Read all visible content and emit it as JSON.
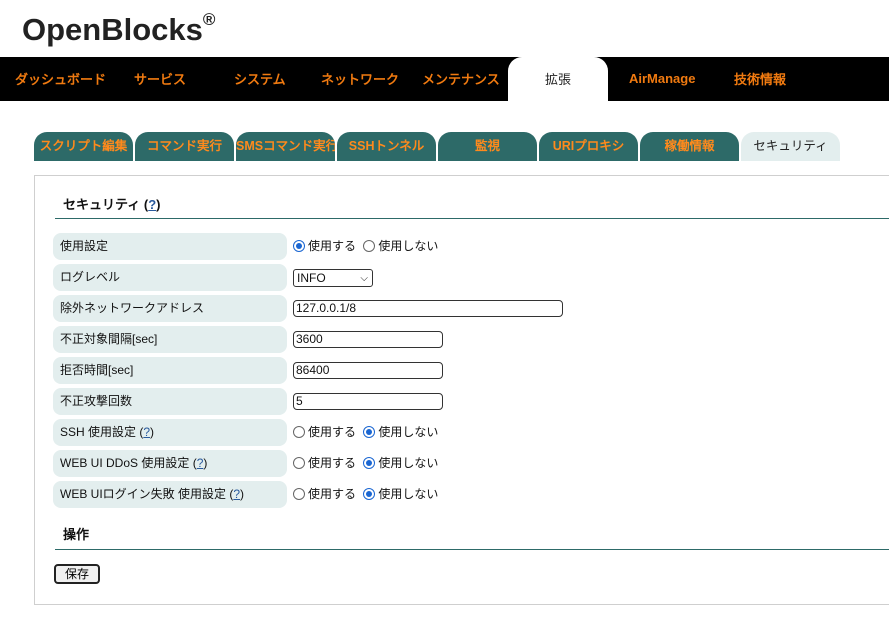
{
  "brand": {
    "name": "OpenBlocks",
    "mark": "®"
  },
  "topnav": {
    "items": [
      {
        "label": "ダッシュボード"
      },
      {
        "label": "サービス"
      },
      {
        "label": "システム"
      },
      {
        "label": "ネットワーク"
      },
      {
        "label": "メンテナンス"
      },
      {
        "label": "拡張",
        "active": true
      },
      {
        "label": "AirManage"
      },
      {
        "label": "技術情報"
      }
    ]
  },
  "subtabs": {
    "items": [
      {
        "label": "スクリプト編集"
      },
      {
        "label": "コマンド実行"
      },
      {
        "label": "SMSコマンド実行"
      },
      {
        "label": "SSHトンネル"
      },
      {
        "label": "監視"
      },
      {
        "label": "URIプロキシ"
      },
      {
        "label": "稼働情報"
      },
      {
        "label": "セキュリティ",
        "active": true
      }
    ]
  },
  "security": {
    "title": "セキュリティ",
    "help_open": "(",
    "help_mark": "?",
    "help_close": ")",
    "rows": {
      "usage": {
        "label": "使用設定",
        "opt_on": "使用する",
        "opt_off": "使用しない",
        "selected": "on"
      },
      "loglevel": {
        "label": "ログレベル",
        "value": "INFO"
      },
      "exclude": {
        "label": "除外ネットワークアドレス",
        "value": "127.0.0.1/8"
      },
      "interval": {
        "label": "不正対象間隔[sec]",
        "value": "3600"
      },
      "deny": {
        "label": "拒否時間[sec]",
        "value": "86400"
      },
      "attempts": {
        "label": "不正攻撃回数",
        "value": "5"
      },
      "ssh": {
        "label": "SSH 使用設定 ",
        "opt_on": "使用する",
        "opt_off": "使用しない",
        "selected": "off"
      },
      "ddos": {
        "label": "WEB UI DDoS 使用設定 ",
        "opt_on": "使用する",
        "opt_off": "使用しない",
        "selected": "off"
      },
      "loginfail": {
        "label": "WEB UIログイン失敗 使用設定 ",
        "opt_on": "使用する",
        "opt_off": "使用しない",
        "selected": "off"
      }
    }
  },
  "operation": {
    "title": "操作",
    "save_label": "保存"
  }
}
